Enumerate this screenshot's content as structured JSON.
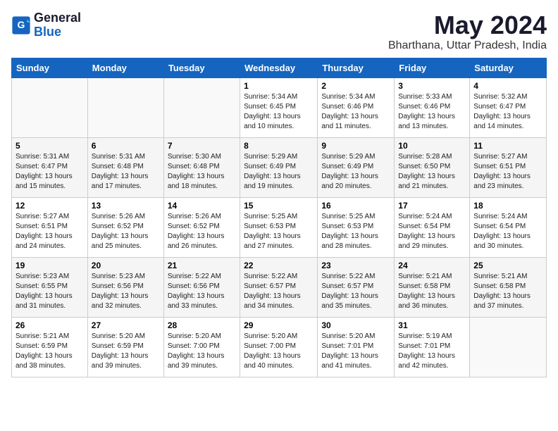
{
  "logo": {
    "line1": "General",
    "line2": "Blue"
  },
  "title": "May 2024",
  "location": "Bharthana, Uttar Pradesh, India",
  "weekdays": [
    "Sunday",
    "Monday",
    "Tuesday",
    "Wednesday",
    "Thursday",
    "Friday",
    "Saturday"
  ],
  "weeks": [
    [
      {
        "day": "",
        "info": ""
      },
      {
        "day": "",
        "info": ""
      },
      {
        "day": "",
        "info": ""
      },
      {
        "day": "1",
        "info": "Sunrise: 5:34 AM\nSunset: 6:45 PM\nDaylight: 13 hours\nand 10 minutes."
      },
      {
        "day": "2",
        "info": "Sunrise: 5:34 AM\nSunset: 6:46 PM\nDaylight: 13 hours\nand 11 minutes."
      },
      {
        "day": "3",
        "info": "Sunrise: 5:33 AM\nSunset: 6:46 PM\nDaylight: 13 hours\nand 13 minutes."
      },
      {
        "day": "4",
        "info": "Sunrise: 5:32 AM\nSunset: 6:47 PM\nDaylight: 13 hours\nand 14 minutes."
      }
    ],
    [
      {
        "day": "5",
        "info": "Sunrise: 5:31 AM\nSunset: 6:47 PM\nDaylight: 13 hours\nand 15 minutes."
      },
      {
        "day": "6",
        "info": "Sunrise: 5:31 AM\nSunset: 6:48 PM\nDaylight: 13 hours\nand 17 minutes."
      },
      {
        "day": "7",
        "info": "Sunrise: 5:30 AM\nSunset: 6:48 PM\nDaylight: 13 hours\nand 18 minutes."
      },
      {
        "day": "8",
        "info": "Sunrise: 5:29 AM\nSunset: 6:49 PM\nDaylight: 13 hours\nand 19 minutes."
      },
      {
        "day": "9",
        "info": "Sunrise: 5:29 AM\nSunset: 6:49 PM\nDaylight: 13 hours\nand 20 minutes."
      },
      {
        "day": "10",
        "info": "Sunrise: 5:28 AM\nSunset: 6:50 PM\nDaylight: 13 hours\nand 21 minutes."
      },
      {
        "day": "11",
        "info": "Sunrise: 5:27 AM\nSunset: 6:51 PM\nDaylight: 13 hours\nand 23 minutes."
      }
    ],
    [
      {
        "day": "12",
        "info": "Sunrise: 5:27 AM\nSunset: 6:51 PM\nDaylight: 13 hours\nand 24 minutes."
      },
      {
        "day": "13",
        "info": "Sunrise: 5:26 AM\nSunset: 6:52 PM\nDaylight: 13 hours\nand 25 minutes."
      },
      {
        "day": "14",
        "info": "Sunrise: 5:26 AM\nSunset: 6:52 PM\nDaylight: 13 hours\nand 26 minutes."
      },
      {
        "day": "15",
        "info": "Sunrise: 5:25 AM\nSunset: 6:53 PM\nDaylight: 13 hours\nand 27 minutes."
      },
      {
        "day": "16",
        "info": "Sunrise: 5:25 AM\nSunset: 6:53 PM\nDaylight: 13 hours\nand 28 minutes."
      },
      {
        "day": "17",
        "info": "Sunrise: 5:24 AM\nSunset: 6:54 PM\nDaylight: 13 hours\nand 29 minutes."
      },
      {
        "day": "18",
        "info": "Sunrise: 5:24 AM\nSunset: 6:54 PM\nDaylight: 13 hours\nand 30 minutes."
      }
    ],
    [
      {
        "day": "19",
        "info": "Sunrise: 5:23 AM\nSunset: 6:55 PM\nDaylight: 13 hours\nand 31 minutes."
      },
      {
        "day": "20",
        "info": "Sunrise: 5:23 AM\nSunset: 6:56 PM\nDaylight: 13 hours\nand 32 minutes."
      },
      {
        "day": "21",
        "info": "Sunrise: 5:22 AM\nSunset: 6:56 PM\nDaylight: 13 hours\nand 33 minutes."
      },
      {
        "day": "22",
        "info": "Sunrise: 5:22 AM\nSunset: 6:57 PM\nDaylight: 13 hours\nand 34 minutes."
      },
      {
        "day": "23",
        "info": "Sunrise: 5:22 AM\nSunset: 6:57 PM\nDaylight: 13 hours\nand 35 minutes."
      },
      {
        "day": "24",
        "info": "Sunrise: 5:21 AM\nSunset: 6:58 PM\nDaylight: 13 hours\nand 36 minutes."
      },
      {
        "day": "25",
        "info": "Sunrise: 5:21 AM\nSunset: 6:58 PM\nDaylight: 13 hours\nand 37 minutes."
      }
    ],
    [
      {
        "day": "26",
        "info": "Sunrise: 5:21 AM\nSunset: 6:59 PM\nDaylight: 13 hours\nand 38 minutes."
      },
      {
        "day": "27",
        "info": "Sunrise: 5:20 AM\nSunset: 6:59 PM\nDaylight: 13 hours\nand 39 minutes."
      },
      {
        "day": "28",
        "info": "Sunrise: 5:20 AM\nSunset: 7:00 PM\nDaylight: 13 hours\nand 39 minutes."
      },
      {
        "day": "29",
        "info": "Sunrise: 5:20 AM\nSunset: 7:00 PM\nDaylight: 13 hours\nand 40 minutes."
      },
      {
        "day": "30",
        "info": "Sunrise: 5:20 AM\nSunset: 7:01 PM\nDaylight: 13 hours\nand 41 minutes."
      },
      {
        "day": "31",
        "info": "Sunrise: 5:19 AM\nSunset: 7:01 PM\nDaylight: 13 hours\nand 42 minutes."
      },
      {
        "day": "",
        "info": ""
      }
    ]
  ]
}
